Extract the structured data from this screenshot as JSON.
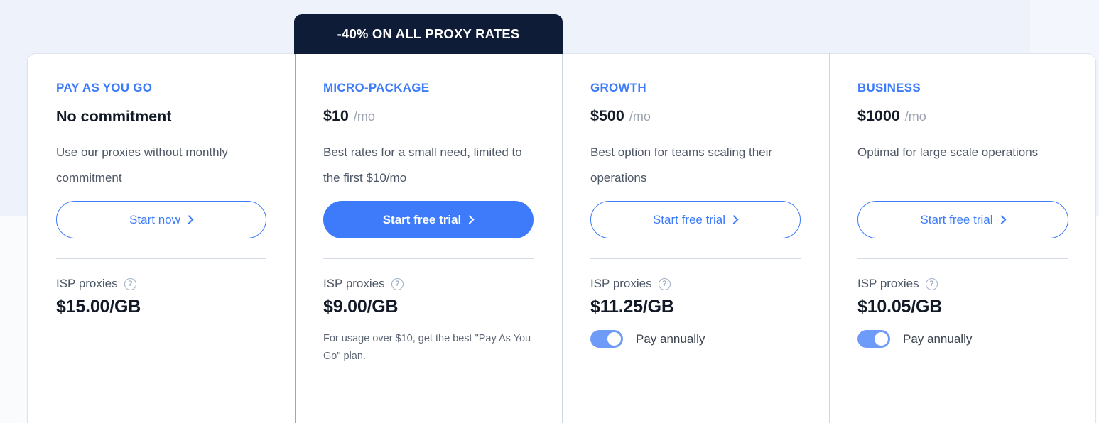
{
  "promo": {
    "banner_text": "-40% ON ALL PROXY RATES"
  },
  "colors": {
    "accent_blue": "#3d7bfb",
    "banner_navy": "#0e1c38",
    "toggle_on": "#6e9bf8",
    "page_tint": "#eef2fa"
  },
  "plans": [
    {
      "name": "PAY AS YOU GO",
      "headline": "No commitment",
      "price": "",
      "period": "",
      "description": "Use our proxies without monthly commitment",
      "cta_label": "Start now",
      "cta_style": "outline",
      "isp_label": "ISP proxies",
      "isp_help_icon": "help-circle-icon",
      "isp_price": "$15.00/GB",
      "note": "",
      "toggle": null
    },
    {
      "name": "MICRO-PACKAGE",
      "headline": "",
      "price": "$10",
      "period": "/mo",
      "description": "Best rates for a small need, limited to the first $10/mo",
      "cta_label": "Start free trial",
      "cta_style": "filled",
      "isp_label": "ISP proxies",
      "isp_help_icon": "help-circle-icon",
      "isp_price": "$9.00/GB",
      "note": "For usage over $10, get the best \"Pay As You Go\" plan.",
      "toggle": null
    },
    {
      "name": "GROWTH",
      "headline": "",
      "price": "$500",
      "period": "/mo",
      "description": "Best option for teams scaling their operations",
      "cta_label": "Start free trial",
      "cta_style": "outline",
      "isp_label": "ISP proxies",
      "isp_help_icon": "help-circle-icon",
      "isp_price": "$11.25/GB",
      "note": "",
      "toggle": {
        "label": "Pay annually",
        "state": "on"
      }
    },
    {
      "name": "BUSINESS",
      "headline": "",
      "price": "$1000",
      "period": "/mo",
      "description": "Optimal for large scale operations",
      "cta_label": "Start free trial",
      "cta_style": "outline",
      "isp_label": "ISP proxies",
      "isp_help_icon": "help-circle-icon",
      "isp_price": "$10.05/GB",
      "note": "",
      "toggle": {
        "label": "Pay annually",
        "state": "on"
      }
    }
  ]
}
